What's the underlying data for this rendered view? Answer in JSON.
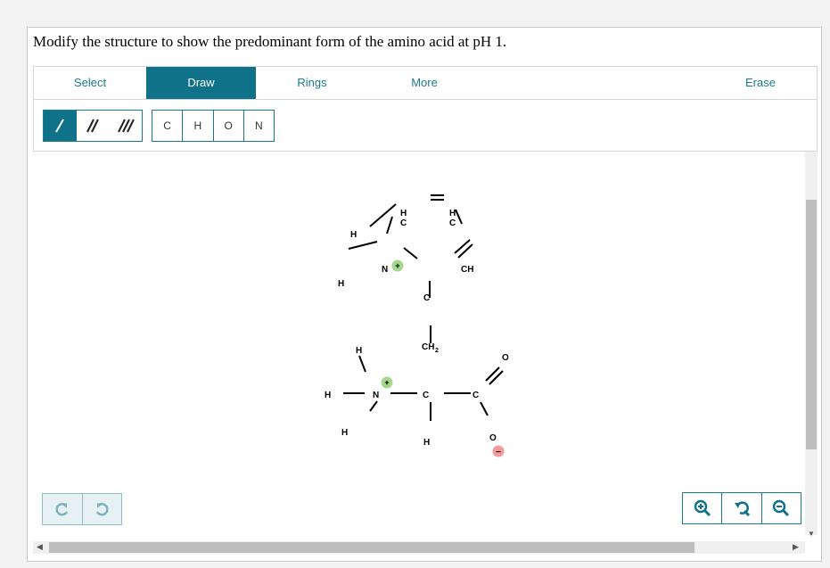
{
  "question": "Modify the structure to show the predominant form of the amino acid at pH 1.",
  "tabs": {
    "select": "Select",
    "draw": "Draw",
    "rings": "Rings",
    "more": "More",
    "erase": "Erase"
  },
  "atoms": {
    "c": "C",
    "h": "H",
    "o": "O",
    "n": "N"
  },
  "molecule": {
    "h": "H",
    "c": "C",
    "n": "N",
    "o": "O",
    "ch": "CH",
    "ch2": "CH",
    "sub2": "2",
    "plus": "+",
    "minus": "−"
  },
  "colors": {
    "accent": "#0f7288",
    "positive": "#a5d88e",
    "negative": "#f39a9a"
  }
}
